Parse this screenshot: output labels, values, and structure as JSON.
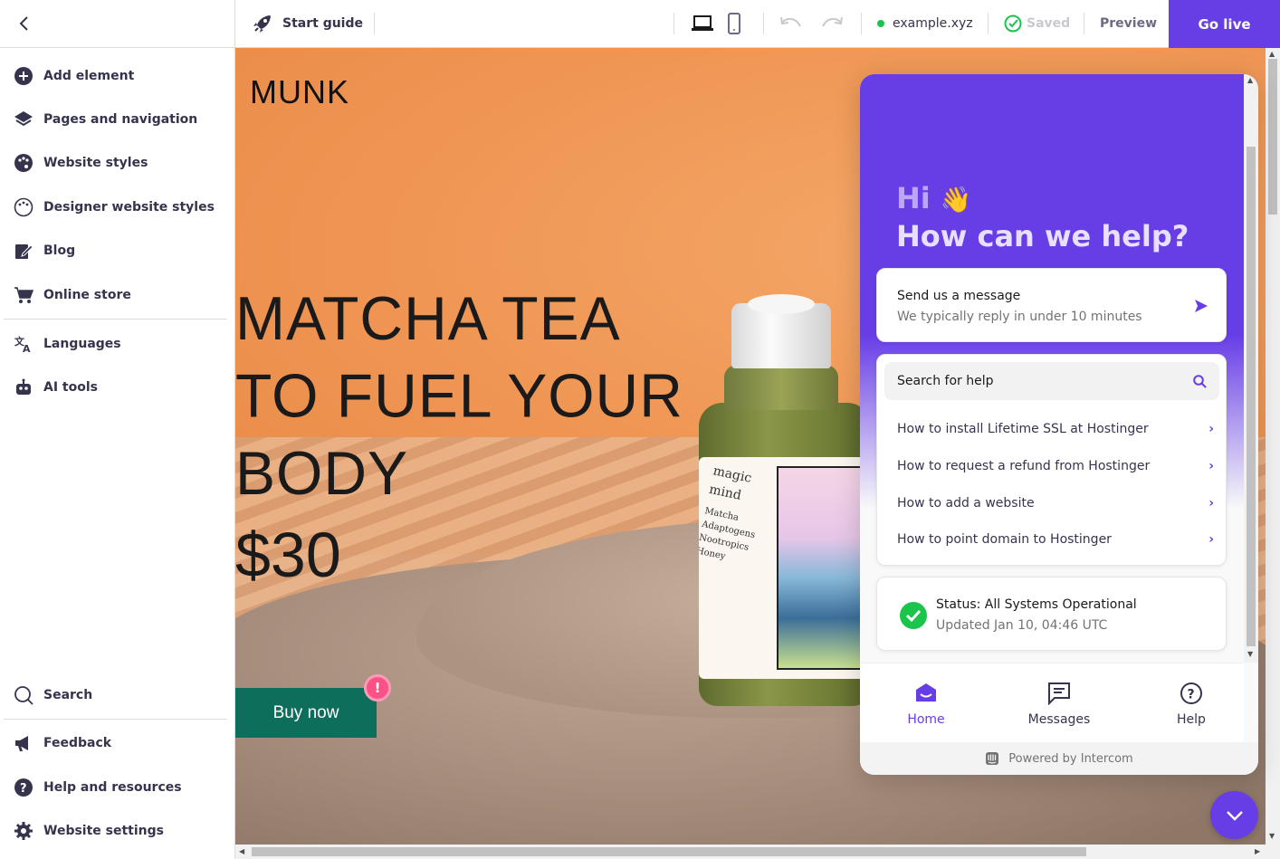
{
  "sidebar": {
    "items": [
      {
        "label": "Add element",
        "icon": "plus-circle-icon"
      },
      {
        "label": "Pages and navigation",
        "icon": "layers-icon"
      },
      {
        "label": "Website styles",
        "icon": "palette-icon"
      },
      {
        "label": "Designer website styles",
        "icon": "palette-outline-icon"
      },
      {
        "label": "Blog",
        "icon": "edit-icon"
      },
      {
        "label": "Online store",
        "icon": "cart-icon"
      },
      {
        "label": "Languages",
        "icon": "translate-icon"
      },
      {
        "label": "AI tools",
        "icon": "robot-icon"
      }
    ],
    "bottom_items": [
      {
        "label": "Search",
        "icon": "search-icon"
      },
      {
        "label": "Feedback",
        "icon": "megaphone-icon"
      },
      {
        "label": "Help and resources",
        "icon": "help-icon"
      },
      {
        "label": "Website settings",
        "icon": "gear-icon"
      }
    ]
  },
  "topbar": {
    "start_guide": "Start guide",
    "domain": "example.xyz",
    "saved": "Saved",
    "preview": "Preview",
    "go_live": "Go live"
  },
  "site": {
    "brand": "MUNK",
    "hero_lines": [
      "MATCHA TEA",
      "TO FUEL YOUR",
      "BODY"
    ],
    "price": "$30",
    "buy_button": "Buy now",
    "alert_badge": "!",
    "jar_text": [
      "magic",
      "mind",
      "Matcha",
      "Adaptogens",
      "Nootropics",
      "Honey"
    ]
  },
  "intercom": {
    "greeting": "Hi",
    "greeting_emoji": "👋",
    "headline": "How can we help?",
    "send_message": {
      "title": "Send us a message",
      "subtitle": "We typically reply in under 10 minutes"
    },
    "search_placeholder": "Search for help",
    "faqs": [
      "How to install Lifetime SSL at Hostinger",
      "How to request a refund from Hostinger",
      "How to add a website",
      "How to point domain to Hostinger"
    ],
    "status": {
      "title": "Status: All Systems Operational",
      "updated": "Updated Jan 10, 04:46 UTC"
    },
    "nav": {
      "home": "Home",
      "messages": "Messages",
      "help": "Help"
    },
    "powered_by": "Powered by Intercom"
  },
  "colors": {
    "accent": "#673de6",
    "buy_button": "#0e6e5c",
    "status_green": "#1bc44b",
    "alert": "#fc5185"
  }
}
